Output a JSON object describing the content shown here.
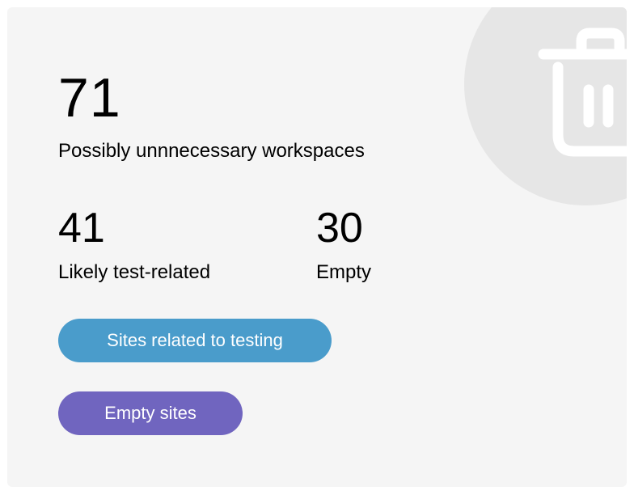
{
  "summary": {
    "total_value": "71",
    "total_label": "Possibly unnnecessary workspaces"
  },
  "stats": [
    {
      "value": "41",
      "label": "Likely test-related"
    },
    {
      "value": "30",
      "label": "Empty"
    }
  ],
  "buttons": {
    "testing_label": "Sites related to testing",
    "empty_label": "Empty sites"
  },
  "icon": "trash-icon",
  "colors": {
    "card_background": "#f5f5f5",
    "decor_circle": "#e6e6e6",
    "testing_button": "#4a9ccb",
    "empty_button": "#7065bf"
  }
}
